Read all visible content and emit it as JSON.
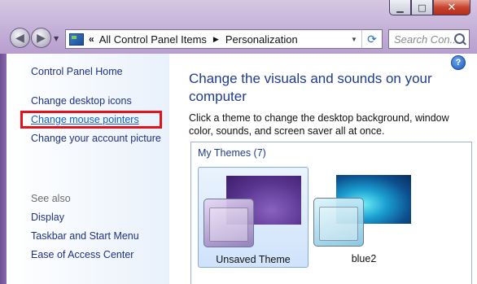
{
  "window": {
    "caption": {
      "minimize": "▁",
      "maximize": "□",
      "close": "✕"
    }
  },
  "nav": {
    "back_icon": "arrow-left-icon",
    "forward_icon": "arrow-right-icon",
    "breadcrumb_prefix": "«",
    "breadcrumb": [
      "All Control Panel Items",
      "Personalization"
    ],
    "breadcrumb_separator": "▶",
    "search_placeholder": "Search Con..."
  },
  "sidebar": {
    "links": [
      {
        "label": "Control Panel Home"
      },
      {
        "label": "Change desktop icons"
      },
      {
        "label": "Change mouse pointers"
      },
      {
        "label": "Change your account picture"
      }
    ],
    "see_also_label": "See also",
    "see_also": [
      {
        "label": "Display"
      },
      {
        "label": "Taskbar and Start Menu"
      },
      {
        "label": "Ease of Access Center"
      }
    ]
  },
  "main": {
    "help_label": "?",
    "heading": "Change the visuals and sounds on your computer",
    "description": "Click a theme to change the desktop background, window color, sounds, and screen saver all at once.",
    "themes_group": "My Themes (7)",
    "themes": [
      {
        "name": "Unsaved Theme",
        "selected": true
      },
      {
        "name": "blue2",
        "selected": false
      }
    ]
  },
  "colors": {
    "highlight_box": "#e3131d",
    "link": "#1e3287",
    "heading": "#1e3d8f"
  }
}
